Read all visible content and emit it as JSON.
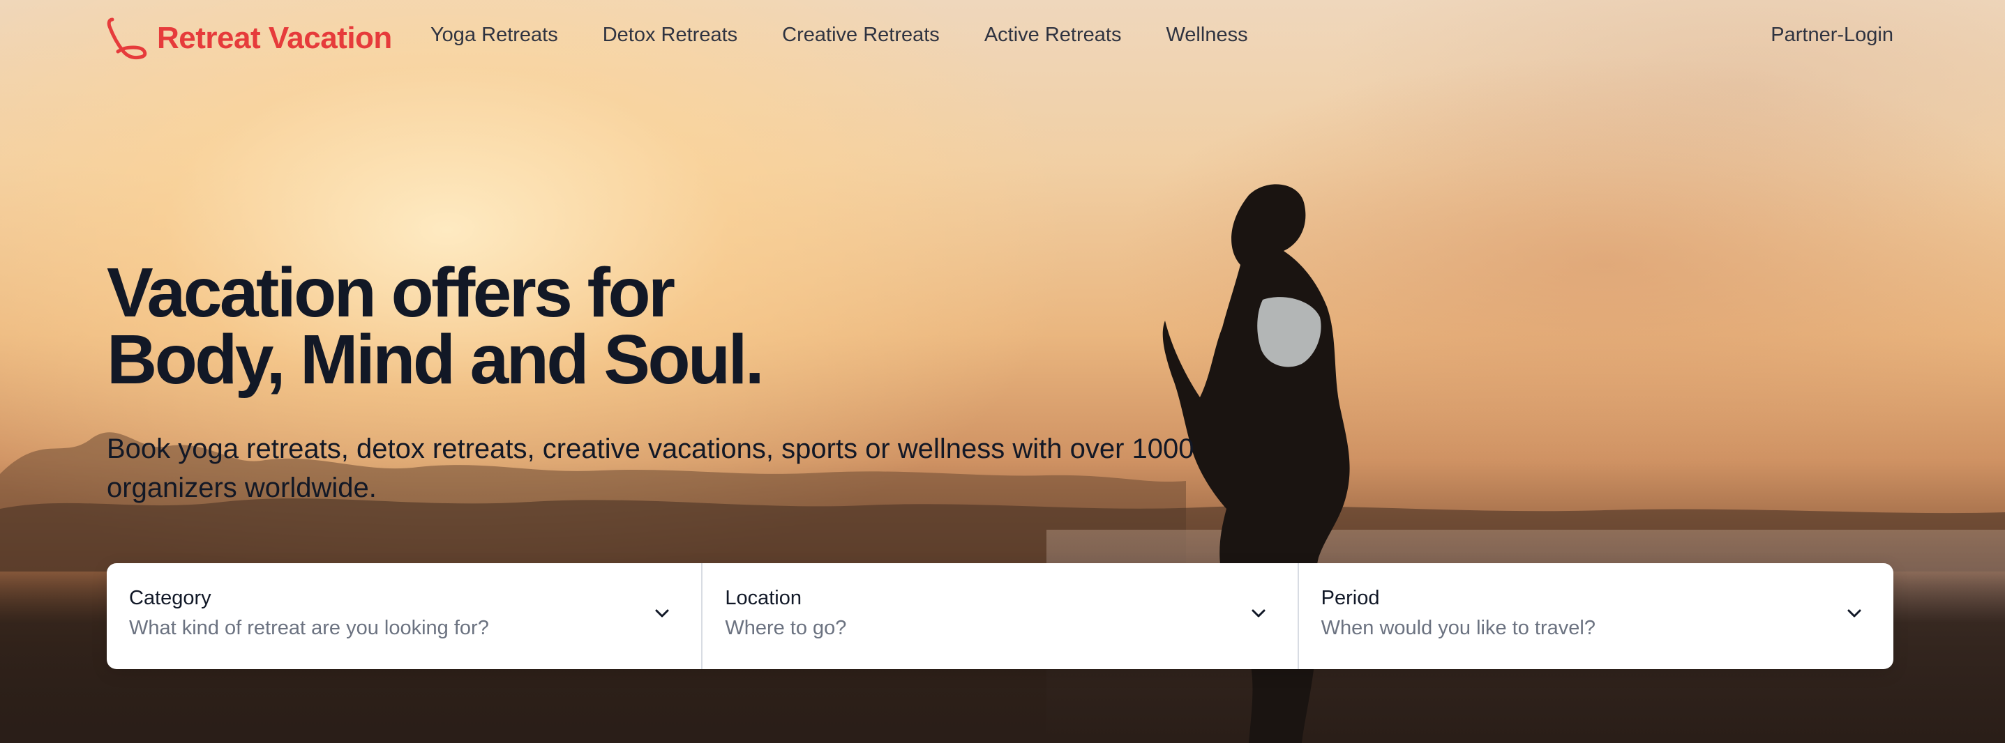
{
  "header": {
    "brand_name": "Retreat Vacation",
    "brand_color": "#e63b3b",
    "logo_icon": "retreat-logo-icon",
    "nav": [
      {
        "label": "Yoga Retreats"
      },
      {
        "label": "Detox Retreats"
      },
      {
        "label": "Creative Retreats"
      },
      {
        "label": "Active Retreats"
      },
      {
        "label": "Wellness"
      }
    ],
    "partner_login_label": "Partner-Login"
  },
  "hero": {
    "headline_line1": "Vacation offers for",
    "headline_line2": "Body, Mind and Soul.",
    "subline": "Book yoga retreats, detox retreats, creative vacations, sports or wellness with over 1000 organizers worldwide.",
    "background_image": "silhouette-of-woman-doing-yoga-on-beach-at-sunset"
  },
  "search": {
    "fields": [
      {
        "label": "Category",
        "placeholder": "What kind of retreat are you looking for?",
        "icon": "chevron-down-icon"
      },
      {
        "label": "Location",
        "placeholder": "Where to go?",
        "icon": "chevron-down-icon"
      },
      {
        "label": "Period",
        "placeholder": "When would you like to travel?",
        "icon": "chevron-down-icon"
      }
    ]
  }
}
